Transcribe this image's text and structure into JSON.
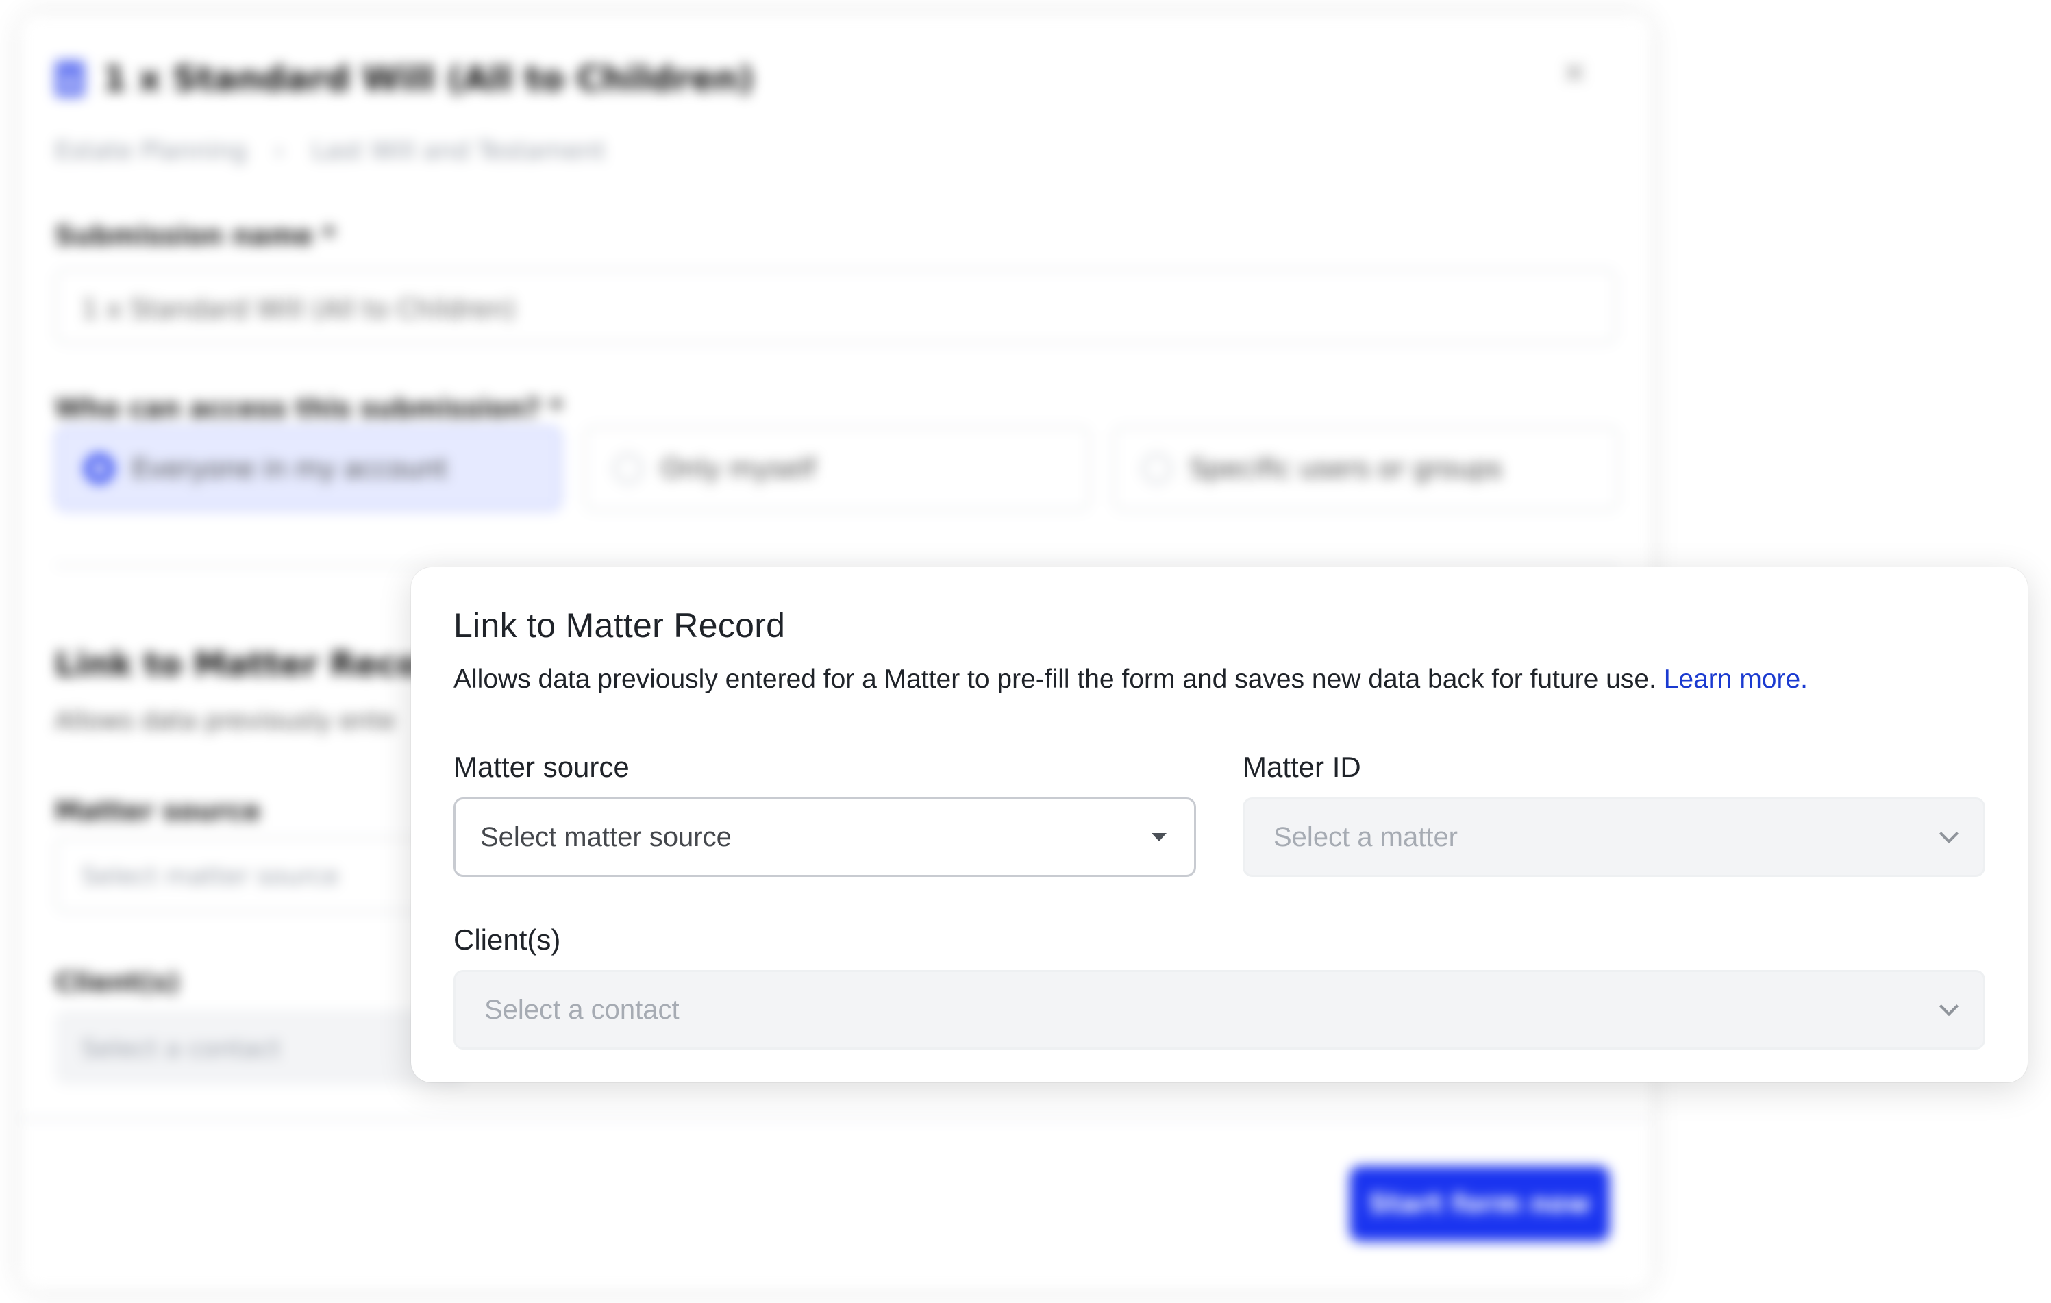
{
  "background_modal": {
    "title": "1 x Standard Will (All to Children)",
    "breadcrumb": [
      "Estate Planning",
      "Last Will and Testament"
    ],
    "submission_name_label": "Submission name *",
    "submission_name_value": "1 x Standard Will (All to Children)",
    "access_label": "Who can access this submission? *",
    "access_options": [
      "Everyone in my account",
      "Only myself",
      "Specific users or groups"
    ],
    "section_title": "Link to Matter Record",
    "section_desc": "Allows data previously ente",
    "matter_source_label": "Matter source",
    "matter_source_placeholder": "Select matter source",
    "clients_label": "Client(s)",
    "clients_placeholder": "Select a contact",
    "start_button": "Start form now"
  },
  "card": {
    "title": "Link to Matter Record",
    "description": "Allows data previously entered for a Matter to pre-fill the form and saves new data back for future use.",
    "learn_more": "Learn more.",
    "matter_source": {
      "label": "Matter source",
      "placeholder": "Select matter source"
    },
    "matter_id": {
      "label": "Matter ID",
      "placeholder": "Select a matter"
    },
    "clients": {
      "label": "Client(s)",
      "placeholder": "Select a contact"
    }
  },
  "icons": {
    "document": "document-icon",
    "close": "close-icon",
    "breadcrumb_separator": "chevron-right-icon",
    "dropdown_caret": "caret-down-icon",
    "dropdown_chevron": "chevron-down-icon"
  },
  "colors": {
    "primary": "#1a34f0",
    "link": "#1a3ad0",
    "selected_radio_bg": "#e6eaff"
  }
}
